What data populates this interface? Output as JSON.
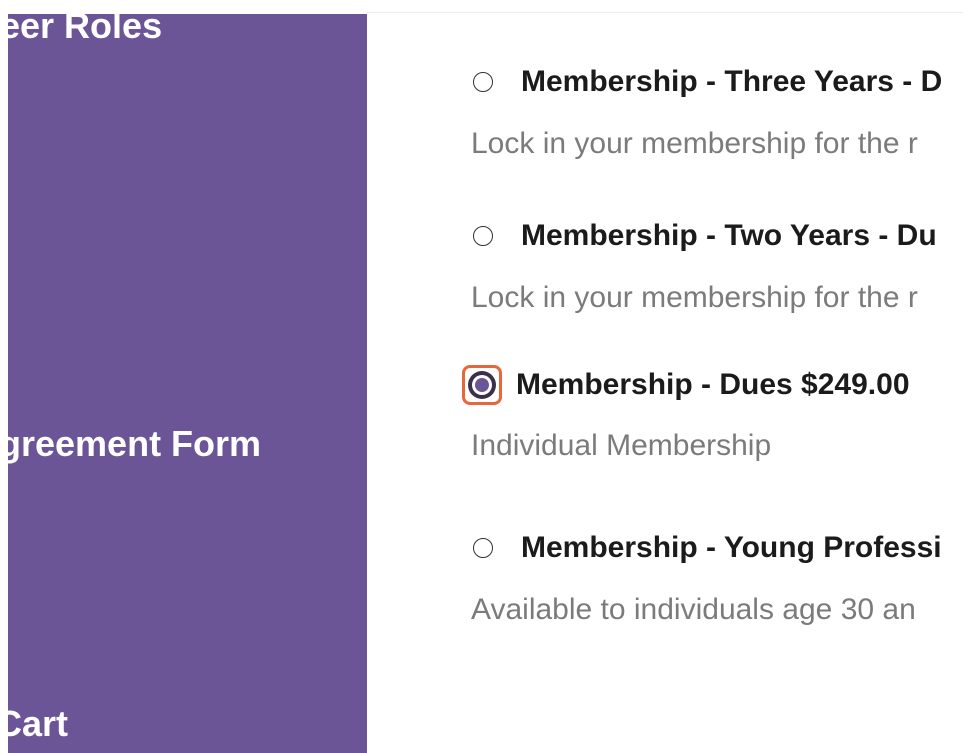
{
  "sidebar": {
    "items": [
      {
        "label": "eer Roles"
      },
      {
        "label": "greement Form"
      },
      {
        "label": "Cart"
      }
    ]
  },
  "options": [
    {
      "title": "Membership - Three Years - D",
      "description": "Lock in your membership for the r",
      "selected": false
    },
    {
      "title": "Membership - Two Years - Du",
      "description": "Lock in your membership for the r",
      "selected": false
    },
    {
      "title": "Membership - Dues $249.00",
      "description": "Individual Membership",
      "selected": true
    },
    {
      "title": "Membership - Young Professi",
      "description": "Available to individuals age 30 an",
      "selected": false
    }
  ],
  "colors": {
    "sidebar_bg": "#6b5596",
    "focus_outline": "#e8663c",
    "title_text": "#1b1b1b",
    "desc_text": "#7b7b7b"
  }
}
